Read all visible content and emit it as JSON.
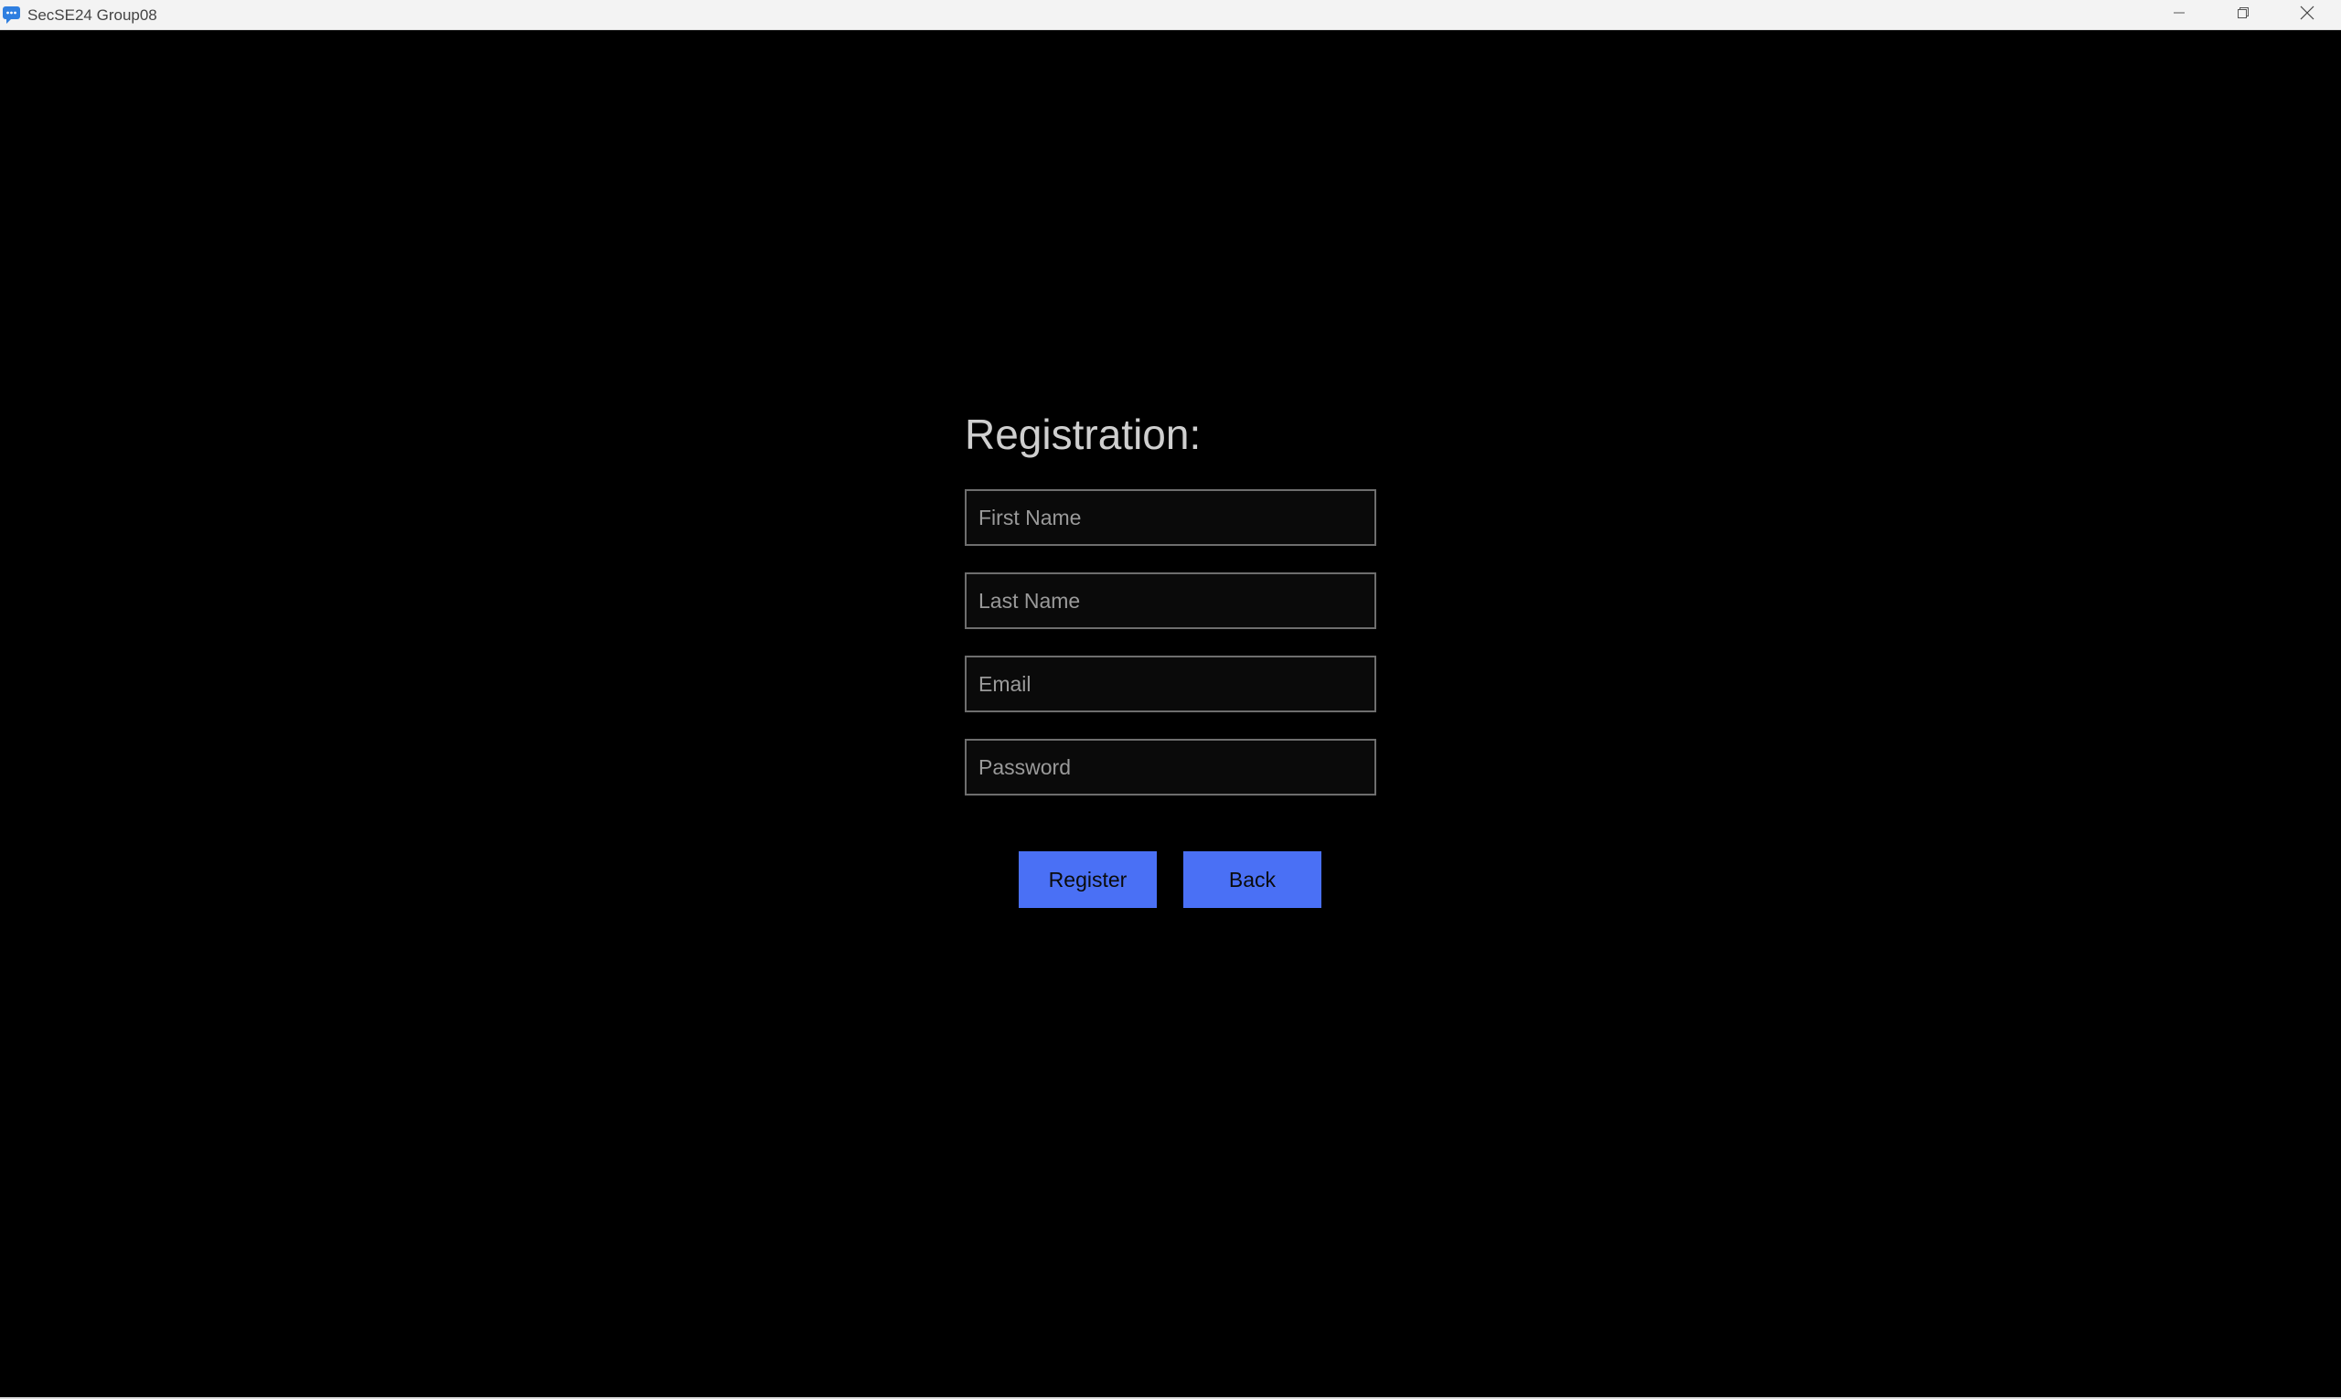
{
  "window": {
    "title": "SecSE24 Group08",
    "icon": "chat-bubble-icon",
    "controls": [
      "minimize-icon",
      "restore-icon",
      "close-icon"
    ]
  },
  "form": {
    "heading": "Registration:",
    "fields": [
      {
        "name": "first-name",
        "placeholder": "First Name",
        "value": ""
      },
      {
        "name": "last-name",
        "placeholder": "Last Name",
        "value": ""
      },
      {
        "name": "email",
        "placeholder": "Email",
        "value": ""
      },
      {
        "name": "password",
        "placeholder": "Password",
        "value": ""
      }
    ],
    "register_label": "Register",
    "back_label": "Back"
  },
  "colors": {
    "background": "#000000",
    "button": "#4a70f5",
    "field_border": "#6e6e6e",
    "heading": "#cfcfcf"
  }
}
